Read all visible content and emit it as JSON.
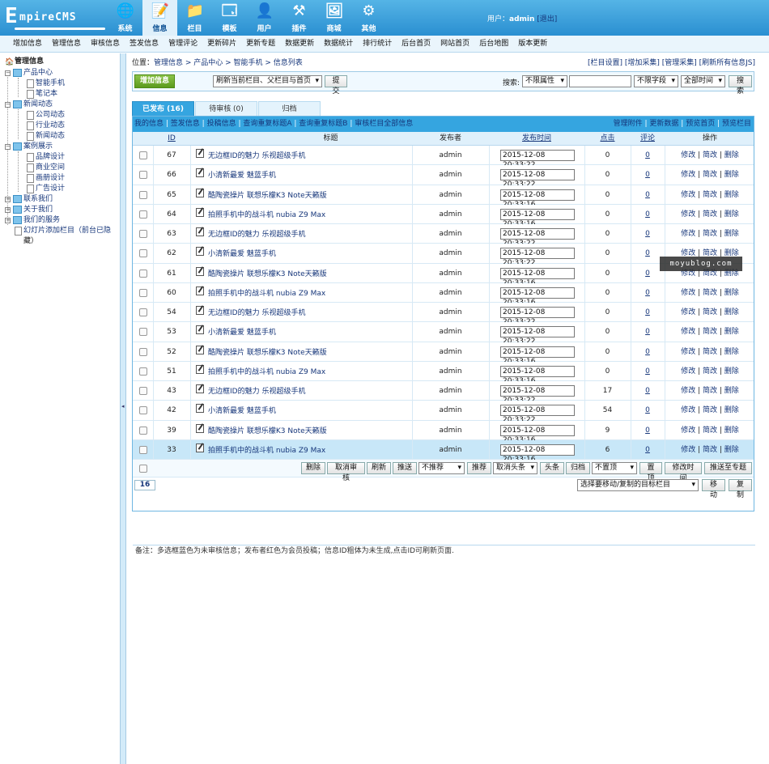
{
  "logo": {
    "text_big": "E",
    "text_rest": "mpireCMS"
  },
  "nav": [
    {
      "label": "系统",
      "icon": "globe-icon"
    },
    {
      "label": "信息",
      "icon": "edit-icon"
    },
    {
      "label": "栏目",
      "icon": "folder-icon"
    },
    {
      "label": "模板",
      "icon": "window-icon"
    },
    {
      "label": "用户",
      "icon": "user-icon"
    },
    {
      "label": "插件",
      "icon": "tools-icon"
    },
    {
      "label": "商城",
      "icon": "shop-icon"
    },
    {
      "label": "其他",
      "icon": "gear-icon"
    }
  ],
  "user": {
    "label": "用户：",
    "name": "admin",
    "logout": "[退出]"
  },
  "submenu": [
    "增加信息",
    "管理信息",
    "审核信息",
    "签发信息",
    "管理评论",
    "更新碎片",
    "更新专题",
    "数据更新",
    "数据统计",
    "排行统计",
    "后台首页",
    "网站首页",
    "后台地图",
    "版本更新"
  ],
  "sidebar": {
    "title": "管理信息",
    "items": [
      {
        "label": "产品中心"
      },
      {
        "label": "智能手机"
      },
      {
        "label": "笔记本"
      },
      {
        "label": "新闻动态"
      },
      {
        "label": "公司动态"
      },
      {
        "label": "行业动态"
      },
      {
        "label": "新闻动态"
      },
      {
        "label": "案例展示"
      },
      {
        "label": "品牌设计"
      },
      {
        "label": "商业空间"
      },
      {
        "label": "画册设计"
      },
      {
        "label": "广告设计"
      },
      {
        "label": "联系我们"
      },
      {
        "label": "关于我们"
      },
      {
        "label": "我们的服务"
      },
      {
        "label": "幻灯片添加栏目（前台已隐"
      },
      {
        "label": "藏）"
      }
    ]
  },
  "breadcrumb": {
    "prefix": "位置：",
    "path": "管理信息 > 产品中心 > 智能手机 > 信息列表"
  },
  "top_links": "[栏目设置] [增加采集] [管理采集] [刷新所有信息JS]",
  "toolbar": {
    "add_label": "增加信息",
    "refresh_select": "刷新当前栏目、父栏目与首页",
    "submit_label": "提交",
    "search_label": "搜索:",
    "attr_select": "不限属性",
    "search_value": "",
    "field_select": "不限字段",
    "time_select": "全部时间",
    "search_button": "搜索"
  },
  "tabs": [
    "已发布 (16)",
    "待审核 (0)",
    "归档"
  ],
  "actionbar": {
    "left": [
      "我的信息",
      "签发信息",
      "投稿信息",
      "查询重复标题A",
      "查询重复标题B",
      "审核栏目全部信息"
    ],
    "right": [
      "管理附件",
      "更新数据",
      "预览首页",
      "预览栏目"
    ]
  },
  "table": {
    "headers": {
      "id": "ID",
      "title": "标题",
      "publisher": "发布者",
      "time": "发布时间",
      "clicks": "点击",
      "comments": "评论",
      "actions": "操作"
    },
    "action_labels": [
      "修改",
      "简改",
      "删除"
    ],
    "rows": [
      {
        "id": "67",
        "title": "无边框ID的魅力 乐视超级手机",
        "publisher": "admin",
        "time": "2015-12-08 20:33:22",
        "clicks": "0",
        "comments": "0"
      },
      {
        "id": "66",
        "title": "小清新最爱 魅蓝手机",
        "publisher": "admin",
        "time": "2015-12-08 20:33:22",
        "clicks": "0",
        "comments": "0"
      },
      {
        "id": "65",
        "title": "酷陶瓷操片 联想乐檬K3 Note天籁版",
        "publisher": "admin",
        "time": "2015-12-08 20:33:16",
        "clicks": "0",
        "comments": "0"
      },
      {
        "id": "64",
        "title": "拍照手机中的战斗机 nubia Z9 Max",
        "publisher": "admin",
        "time": "2015-12-08 20:33:16",
        "clicks": "0",
        "comments": "0"
      },
      {
        "id": "63",
        "title": "无边框ID的魅力 乐视超级手机",
        "publisher": "admin",
        "time": "2015-12-08 20:33:22",
        "clicks": "0",
        "comments": "0"
      },
      {
        "id": "62",
        "title": "小清新最爱 魅蓝手机",
        "publisher": "admin",
        "time": "2015-12-08 20:33:22",
        "clicks": "0",
        "comments": "0"
      },
      {
        "id": "61",
        "title": "酷陶瓷操片 联想乐檬K3 Note天籁版",
        "publisher": "admin",
        "time": "2015-12-08 20:33:16",
        "clicks": "0",
        "comments": "0"
      },
      {
        "id": "60",
        "title": "拍照手机中的战斗机 nubia Z9 Max",
        "publisher": "admin",
        "time": "2015-12-08 20:33:16",
        "clicks": "0",
        "comments": "0"
      },
      {
        "id": "54",
        "title": "无边框ID的魅力 乐视超级手机",
        "publisher": "admin",
        "time": "2015-12-08 20:33:22",
        "clicks": "0",
        "comments": "0"
      },
      {
        "id": "53",
        "title": "小清新最爱 魅蓝手机",
        "publisher": "admin",
        "time": "2015-12-08 20:33:22",
        "clicks": "0",
        "comments": "0"
      },
      {
        "id": "52",
        "title": "酷陶瓷操片 联想乐檬K3 Note天籁版",
        "publisher": "admin",
        "time": "2015-12-08 20:33:16",
        "clicks": "0",
        "comments": "0"
      },
      {
        "id": "51",
        "title": "拍照手机中的战斗机 nubia Z9 Max",
        "publisher": "admin",
        "time": "2015-12-08 20:33:16",
        "clicks": "0",
        "comments": "0"
      },
      {
        "id": "43",
        "title": "无边框ID的魅力 乐视超级手机",
        "publisher": "admin",
        "time": "2015-12-08 20:33:22",
        "clicks": "17",
        "comments": "0"
      },
      {
        "id": "42",
        "title": "小清新最爱 魅蓝手机",
        "publisher": "admin",
        "time": "2015-12-08 20:33:22",
        "clicks": "54",
        "comments": "0"
      },
      {
        "id": "39",
        "title": "酷陶瓷操片 联想乐檬K3 Note天籁版",
        "publisher": "admin",
        "time": "2015-12-08 20:33:16",
        "clicks": "9",
        "comments": "0"
      },
      {
        "id": "33",
        "title": "拍照手机中的战斗机 nubia Z9 Max",
        "publisher": "admin",
        "time": "2015-12-08 20:33:16",
        "clicks": "6",
        "comments": "0"
      }
    ]
  },
  "bulk": {
    "delete": "删除",
    "unaudit": "取消审核",
    "refresh": "刷新",
    "push": "推送",
    "recommend_select": "不推荐",
    "recommend_btn": "推荐",
    "headline_select": "取消头条",
    "headline_btn": "头条",
    "archive_btn": "归档",
    "top_select": "不置顶",
    "top_btn": "置顶",
    "modtime_btn": "修改时间",
    "topic_btn": "推送至专题"
  },
  "pager": {
    "count": "16",
    "move_select": "选择要移动/复制的目标栏目",
    "move_btn": "移动",
    "copy_btn": "复制"
  },
  "note": "备注：多选框蓝色为未审核信息；发布者红色为会员投稿；信息ID粗体为未生成,点击ID可刷新页面.",
  "watermark": "moyublog.com"
}
